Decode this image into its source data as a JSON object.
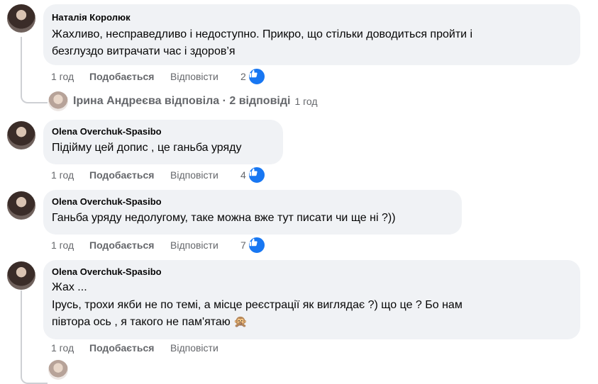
{
  "comments": [
    {
      "author": "Наталія Королюк",
      "lines": [
        "Жахливо, несправедливо і недоступно. Прикро, що стільки доводиться пройти і",
        "безглуздо витрачати час і здоров’я"
      ],
      "time": "1 год",
      "like_label": "Подобається",
      "reply_label": "Відповісти",
      "likes": "2"
    },
    {
      "author": "Olena Overchuk-Spasibo",
      "lines": [
        "Підійму цей допис , це ганьба уряду"
      ],
      "time": "1 год",
      "like_label": "Подобається",
      "reply_label": "Відповісти",
      "likes": "4"
    },
    {
      "author": "Olena Overchuk-Spasibo",
      "lines": [
        "Ганьба уряду недолугому, таке можна вже тут писати чи ще ні ?))"
      ],
      "time": "1 год",
      "like_label": "Подобається",
      "reply_label": "Відповісти",
      "likes": "7"
    },
    {
      "author": "Olena Overchuk-Spasibo",
      "lines": [
        "Жах ...",
        "Ірусь, трохи якби не по темі, а місце реєстрації як виглядає ?) що це ? Бо нам",
        "півтора ось , я такого не пам'ятаю"
      ],
      "emoji": "🙊",
      "time": "1 год",
      "like_label": "Подобається",
      "reply_label": "Відповісти"
    }
  ],
  "reply_summary": {
    "text": "Ірина Андреєва відповіла · 2 відповіді",
    "time": "1 год"
  },
  "colors": {
    "like_blue": "#1877f2",
    "bubble": "#f0f2f5",
    "meta_gray": "#65676b"
  }
}
